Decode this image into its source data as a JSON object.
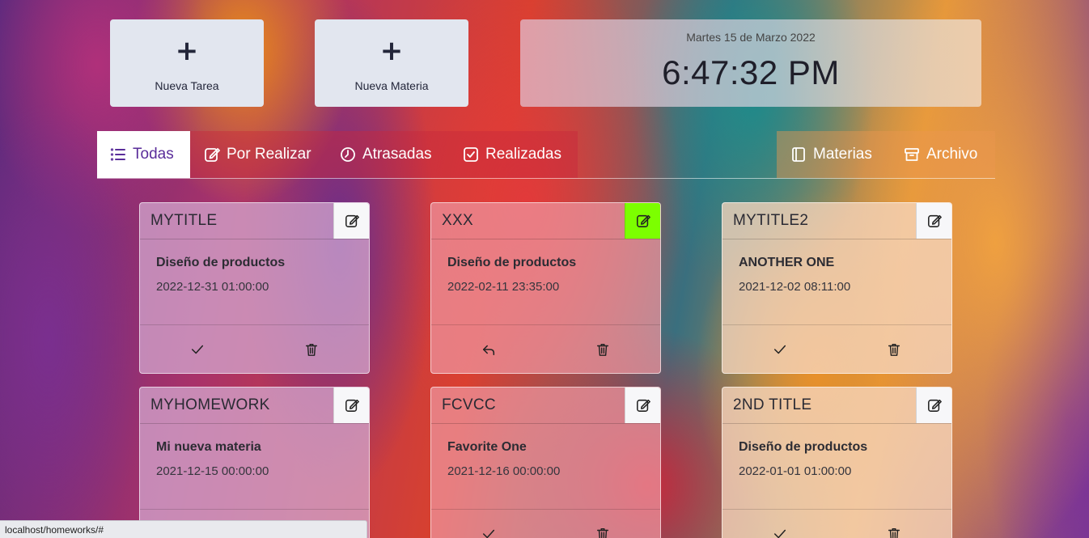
{
  "actions": {
    "new_task": {
      "icon": "plus-icon",
      "label": "Nueva Tarea"
    },
    "new_subject": {
      "icon": "plus-icon",
      "label": "Nueva Materia"
    }
  },
  "clock": {
    "date": "Martes 15 de Marzo 2022",
    "time": "6:47:32 PM"
  },
  "tabs": [
    {
      "label": "Todas",
      "icon": "list-icon",
      "active": true
    },
    {
      "label": "Por Realizar",
      "icon": "edit-icon",
      "active": false
    },
    {
      "label": "Atrasadas",
      "icon": "clock-icon",
      "active": false
    },
    {
      "label": "Realizadas",
      "icon": "check-square-icon",
      "active": false
    },
    {
      "label": "Materias",
      "icon": "book-icon",
      "active": false
    },
    {
      "label": "Archivo",
      "icon": "archive-icon",
      "active": false
    }
  ],
  "cards": [
    {
      "title": "MYTITLE",
      "subject": "Diseño de productos",
      "date": "2022-12-31 01:00:00",
      "primary_action": "check-icon",
      "edit_highlight": false
    },
    {
      "title": "XXX",
      "subject": "Diseño de productos",
      "date": "2022-02-11 23:35:00",
      "primary_action": "undo-icon",
      "edit_highlight": true,
      "highlight_color": "#7cff00"
    },
    {
      "title": "MYTITLE2",
      "subject": "ANOTHER ONE",
      "date": "2021-12-02 08:11:00",
      "primary_action": "check-icon",
      "edit_highlight": false
    },
    {
      "title": "MYHOMEWORK",
      "subject": "Mi nueva materia",
      "date": "2021-12-15 00:00:00",
      "primary_action": "check-icon",
      "edit_highlight": false
    },
    {
      "title": "FCVCC",
      "subject": "Favorite One",
      "date": "2021-12-16 00:00:00",
      "primary_action": "check-icon",
      "edit_highlight": false
    },
    {
      "title": "2ND TITLE",
      "subject": "Diseño de productos",
      "date": "2022-01-01 01:00:00",
      "primary_action": "check-icon",
      "edit_highlight": false
    }
  ],
  "status_bar": {
    "url": "localhost/homeworks/#"
  },
  "colors": {
    "active_tab_text": "#5a2d9a",
    "highlight": "#7cff00"
  }
}
